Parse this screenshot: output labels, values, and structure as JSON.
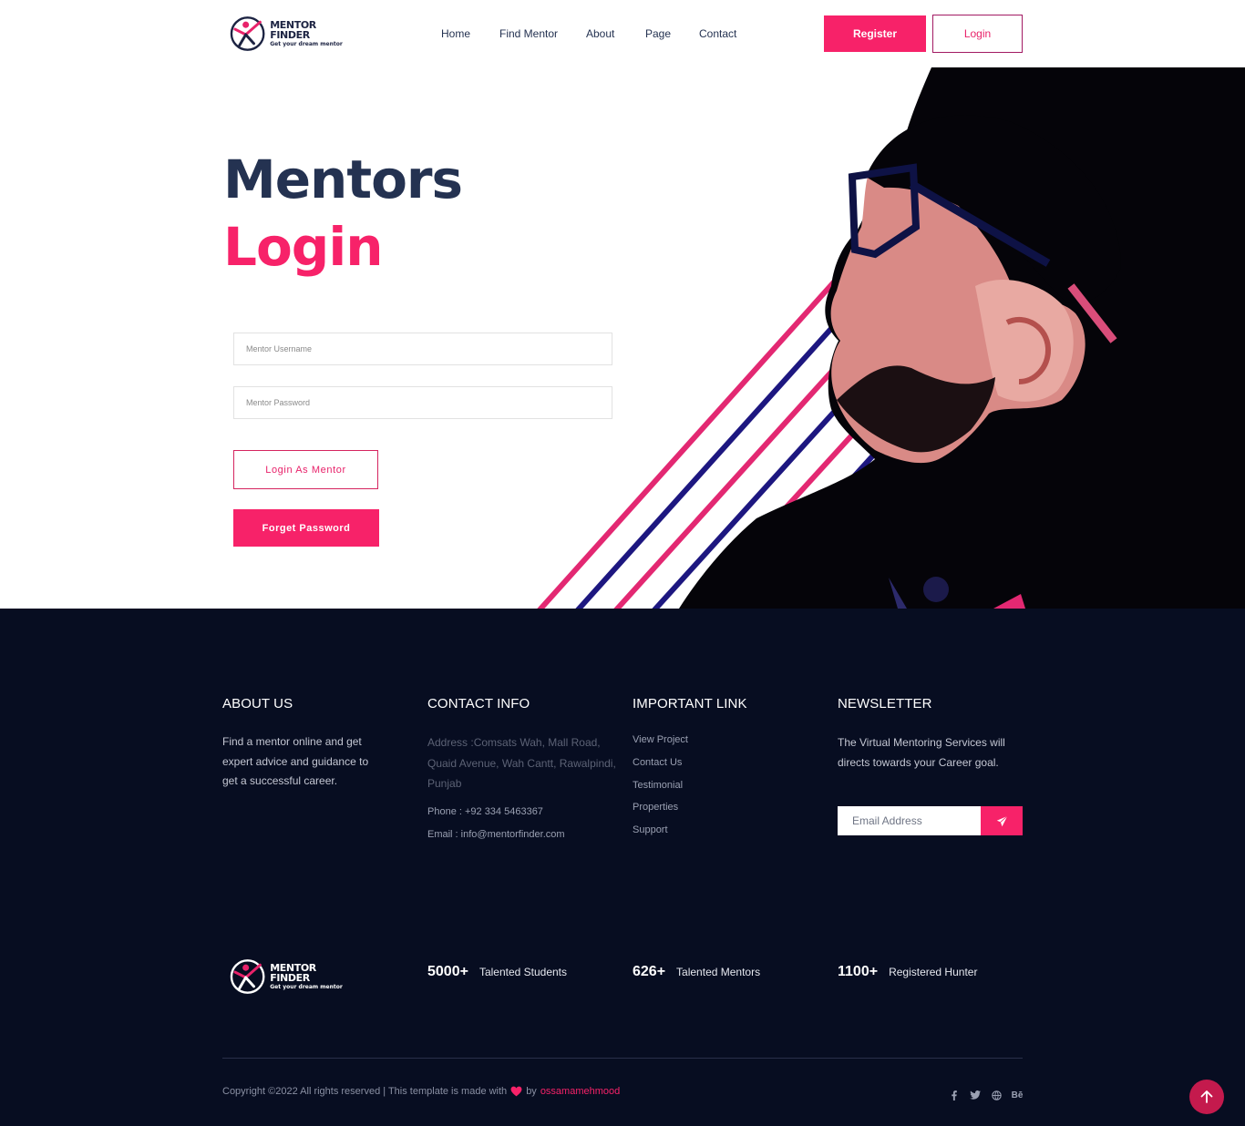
{
  "brand": {
    "name": "MENTOR FINDER",
    "tagline": "Get your dream mentor",
    "accent": "#f72269",
    "navy": "#243251",
    "footer_bg": "#070d21"
  },
  "header": {
    "nav": [
      "Home",
      "Find Mentor",
      "About",
      "Page",
      "Contact"
    ],
    "register_label": "Register",
    "login_label": "Login"
  },
  "hero": {
    "title_line1": "Mentors",
    "title_line2": "Login",
    "username_placeholder": "Mentor Username",
    "password_placeholder": "Mentor Password",
    "login_button": "Login As Mentor",
    "forget_button": "Forget Password"
  },
  "footer": {
    "about": {
      "title": "ABOUT US",
      "text": "Find a mentor online and get expert advice and guidance to get a successful career."
    },
    "contact": {
      "title": "CONTACT INFO",
      "address": "Address :Comsats Wah, Mall Road, Quaid Avenue, Wah Cantt, Rawalpindi, Punjab",
      "phone": "Phone : +92 334 5463367",
      "email": "Email : info@mentorfinder.com"
    },
    "links": {
      "title": "IMPORTANT LINK",
      "items": [
        "View Project",
        "Contact Us",
        "Testimonial",
        "Properties",
        "Support"
      ]
    },
    "newsletter": {
      "title": "NEWSLETTER",
      "text": "The Virtual Mentoring Services will directs towards your Career goal.",
      "email_placeholder": "Email Address",
      "send_icon": "paper-plane-icon"
    },
    "stats": [
      {
        "number": "5000+",
        "label": "Talented Students"
      },
      {
        "number": "626+",
        "label": "Talented Mentors"
      },
      {
        "number": "1100+",
        "label": "Registered Hunter"
      }
    ],
    "copyright_prefix": "Copyright ©2022 All rights reserved | This template is made with",
    "copyright_by": "by",
    "copyright_author": "ossamamehmood",
    "socials": [
      "facebook-icon",
      "twitter-icon",
      "globe-icon",
      "behance-icon"
    ],
    "social_behance_text": "Bē"
  }
}
